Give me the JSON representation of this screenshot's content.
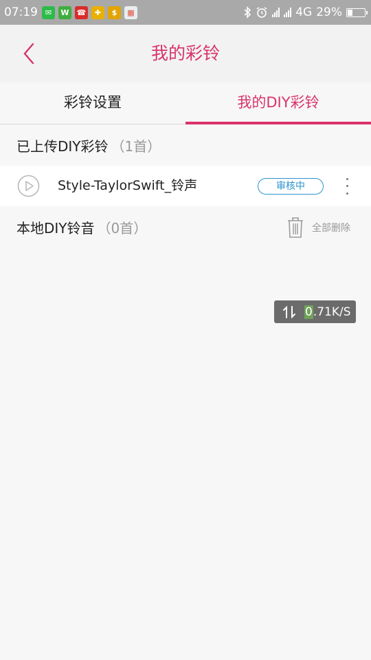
{
  "status_bar": {
    "time": "07:19",
    "app_icons": [
      {
        "icon": "wechat-icon",
        "color": "#2dbb4a",
        "glyph": "✉"
      },
      {
        "icon": "wps-icon",
        "color": "#3fae3f",
        "glyph": "W"
      },
      {
        "icon": "news-icon",
        "color": "#d92c2c",
        "glyph": "☎"
      },
      {
        "icon": "game-icon",
        "color": "#e9b000",
        "glyph": "✚"
      },
      {
        "icon": "coin-app-icon",
        "color": "#e2a500",
        "glyph": "$"
      },
      {
        "icon": "gallery-icon",
        "color": "#e8eef0",
        "glyph": "▦"
      }
    ],
    "network": "4G",
    "battery": "29%",
    "battery_level": 0.29
  },
  "header": {
    "title": "我的彩铃"
  },
  "tabs": [
    {
      "label": "彩铃设置",
      "active": false
    },
    {
      "label": "我的DIY彩铃",
      "active": true
    }
  ],
  "uploaded_section": {
    "title": "已上传DIY彩铃",
    "count": "（1首）",
    "items": [
      {
        "name": "Style-TaylorSwift_铃声",
        "status": "审核中"
      }
    ]
  },
  "local_section": {
    "title": "本地DIY铃音",
    "count": "（0首）",
    "delete_all_label": "全部删除"
  },
  "net_speed": {
    "value_highlight": "0",
    "value_rest": ".71K/S"
  },
  "colors": {
    "accent": "#d8336c",
    "badge": "#2a92cf"
  }
}
